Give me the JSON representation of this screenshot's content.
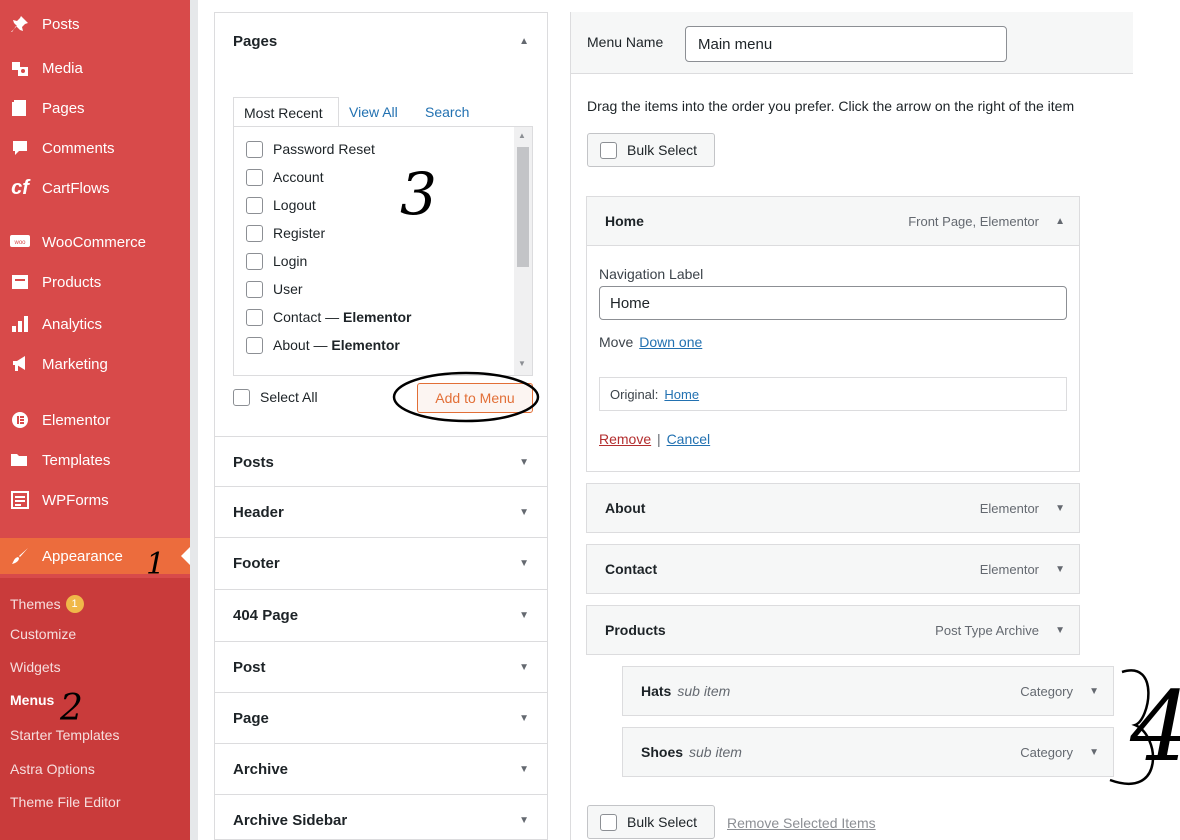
{
  "sidebar": {
    "items": [
      {
        "label": "Posts",
        "icon": "pin-icon"
      },
      {
        "label": "Media",
        "icon": "media-icon"
      },
      {
        "label": "Pages",
        "icon": "pages-icon"
      },
      {
        "label": "Comments",
        "icon": "comment-icon"
      },
      {
        "label": "CartFlows",
        "icon": "cartflows-icon"
      },
      {
        "label": "WooCommerce",
        "icon": "woocommerce-icon"
      },
      {
        "label": "Products",
        "icon": "products-icon"
      },
      {
        "label": "Analytics",
        "icon": "analytics-icon"
      },
      {
        "label": "Marketing",
        "icon": "megaphone-icon"
      },
      {
        "label": "Elementor",
        "icon": "elementor-icon"
      },
      {
        "label": "Templates",
        "icon": "folder-icon"
      },
      {
        "label": "WPForms",
        "icon": "wpforms-icon"
      },
      {
        "label": "Appearance",
        "icon": "paintbrush-icon"
      }
    ],
    "submenu": [
      {
        "label": "Themes",
        "badge": "1"
      },
      {
        "label": "Customize"
      },
      {
        "label": "Widgets"
      },
      {
        "label": "Menus"
      },
      {
        "label": "Starter Templates"
      },
      {
        "label": "Astra Options"
      },
      {
        "label": "Theme File Editor"
      }
    ],
    "colors": {
      "background": "#d84a4a",
      "active": "#ec6c3d",
      "submenu": "#c93b3b"
    }
  },
  "left_panel": {
    "pages_title": "Pages",
    "tabs": [
      "Most Recent",
      "View All",
      "Search"
    ],
    "pages": [
      "Password Reset",
      "Account",
      "Logout",
      "Register",
      "Login",
      "User",
      "Contact",
      "About"
    ],
    "elementor_suffix": "Elementor",
    "dash": " — ",
    "select_all": "Select All",
    "add_button": "Add to Menu",
    "sections": [
      "Posts",
      "Header",
      "Footer",
      "404 Page",
      "Post",
      "Page",
      "Archive",
      "Archive Sidebar"
    ]
  },
  "right_panel": {
    "menu_name_label": "Menu Name",
    "menu_name_value": "Main menu",
    "instructions": "Drag the items into the order you prefer. Click the arrow on the right of the item",
    "bulk_select": "Bulk Select",
    "items": [
      {
        "title": "Home",
        "type": "Front Page, Elementor"
      },
      {
        "title": "About",
        "type": "Elementor"
      },
      {
        "title": "Contact",
        "type": "Elementor"
      },
      {
        "title": "Products",
        "type": "Post Type Archive"
      },
      {
        "title": "Hats",
        "sub": "sub item",
        "type": "Category"
      },
      {
        "title": "Shoes",
        "sub": "sub item",
        "type": "Category"
      }
    ],
    "home_settings": {
      "nav_label_title": "Navigation Label",
      "nav_label_value": "Home",
      "move_label": "Move",
      "move_link": "Down one",
      "original_label": "Original:",
      "original_link": "Home",
      "remove": "Remove",
      "separator": "|",
      "cancel": "Cancel"
    },
    "remove_selected": "Remove Selected Items"
  },
  "annotations": [
    "1",
    "2",
    "3",
    "4"
  ]
}
